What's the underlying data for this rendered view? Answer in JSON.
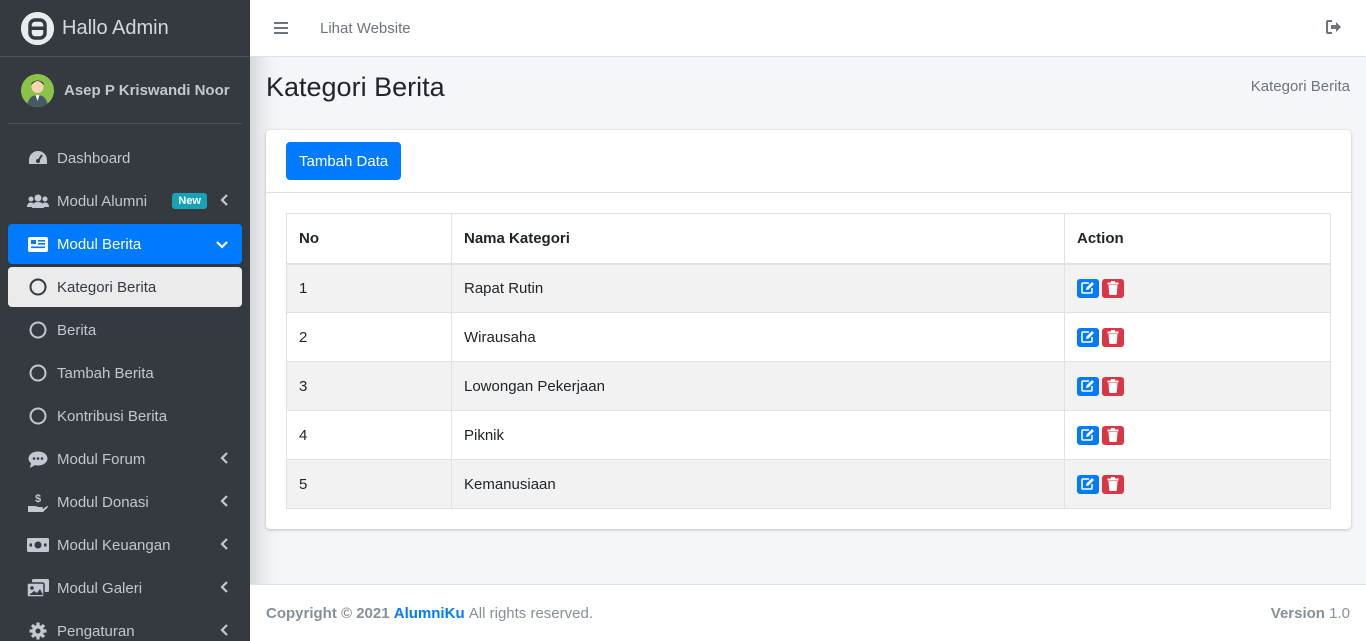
{
  "brand": {
    "title": "Hallo Admin"
  },
  "user": {
    "name": "Asep P Kriswandi Noor"
  },
  "sidebar": {
    "items": [
      {
        "label": "Dashboard",
        "icon": "dashboard-icon"
      },
      {
        "label": "Modul Alumni",
        "icon": "users-icon",
        "badge": "New"
      },
      {
        "label": "Modul Berita",
        "icon": "news-icon"
      },
      {
        "label": "Kategori Berita",
        "icon": "circle-icon"
      },
      {
        "label": "Berita",
        "icon": "circle-icon"
      },
      {
        "label": "Tambah Berita",
        "icon": "circle-icon"
      },
      {
        "label": "Kontribusi Berita",
        "icon": "circle-icon"
      },
      {
        "label": "Modul Forum",
        "icon": "comment-icon"
      },
      {
        "label": "Modul Donasi",
        "icon": "donate-icon"
      },
      {
        "label": "Modul Keuangan",
        "icon": "money-icon"
      },
      {
        "label": "Modul Galeri",
        "icon": "gallery-icon"
      },
      {
        "label": "Pengaturan",
        "icon": "gear-icon"
      }
    ]
  },
  "header": {
    "link": "Lihat Website"
  },
  "page": {
    "title": "Kategori Berita",
    "breadcrumb": "Kategori Berita"
  },
  "card": {
    "add_button": "Tambah Data"
  },
  "table": {
    "headers": [
      "No",
      "Nama Kategori",
      "Action"
    ],
    "rows": [
      {
        "no": "1",
        "nama": "Rapat Rutin"
      },
      {
        "no": "2",
        "nama": "Wirausaha"
      },
      {
        "no": "3",
        "nama": "Lowongan Pekerjaan"
      },
      {
        "no": "4",
        "nama": "Piknik"
      },
      {
        "no": "5",
        "nama": "Kemanusiaan"
      }
    ]
  },
  "footer": {
    "copyright": "Copyright © 2021",
    "brand_a": "Alumni",
    "brand_b": "Ku",
    "rights": "All rights reserved.",
    "version_label": "Version",
    "version": "1.0"
  },
  "colors": {
    "primary": "#007bff",
    "danger": "#dc3545",
    "info": "#17a2b8",
    "sidebar": "#343a40"
  }
}
